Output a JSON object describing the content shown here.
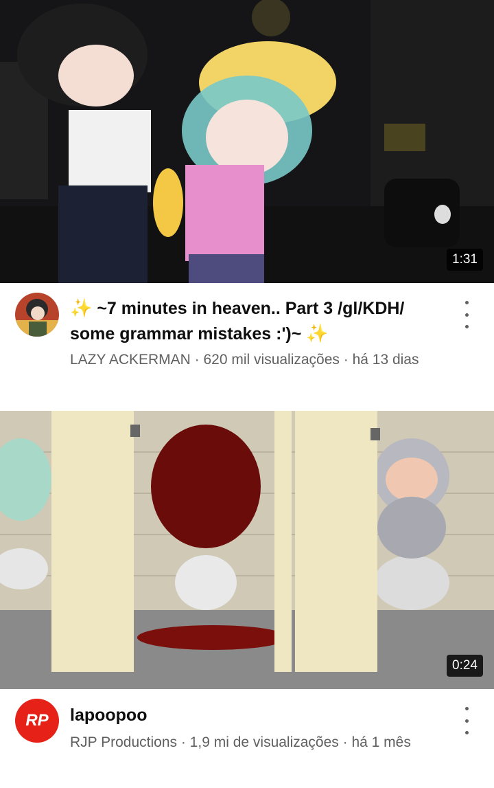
{
  "videos": [
    {
      "duration": "1:31",
      "title_prefix_icon": "sparkles-icon",
      "title": "~7 minutes in heaven.. Part 3 /gl/KDH/ some grammar mistakes :')~",
      "title_suffix_icon": "sparkles-icon",
      "channel": "LAZY ACKERMAN",
      "meta_line": "LAZY ACKERMAN · 620 mil visualizações · há 13 dias",
      "avatar_icon": "channel-avatar-anime"
    },
    {
      "duration": "0:24",
      "title": "lapoopoo",
      "channel": "RJP Productions",
      "meta_line": "RJP Productions · 1,9 mi de visualizações · há 1 mês",
      "avatar_text": "RP",
      "avatar_color": "#e62117"
    }
  ]
}
